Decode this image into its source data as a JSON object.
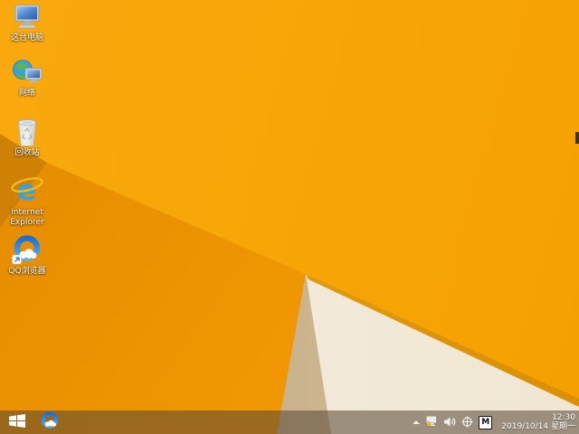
{
  "wallpaper": {
    "base_color": "#F7A506",
    "facet_dark_color": "#CE8104",
    "facet_medium_color": "#EE9402",
    "facet_cream_color": "#F2EADA",
    "facet_taupe_color": "#C9AF85",
    "edge_line_color": "#DC9510"
  },
  "desktop": {
    "icons": [
      {
        "name": "this-pc",
        "label": "这台电脑"
      },
      {
        "name": "network",
        "label": "网络"
      },
      {
        "name": "recycle-bin",
        "label": "回收站"
      },
      {
        "name": "internet-explorer",
        "label": "Internet Explorer"
      },
      {
        "name": "qq-browser",
        "label": "QQ浏览器"
      }
    ]
  },
  "taskbar": {
    "start_button": "windows-start",
    "pinned": [
      {
        "name": "qq-browser"
      }
    ],
    "tray": {
      "icons": [
        "show-hidden-icons",
        "network-warning",
        "volume",
        "crosshair-tool",
        "ime-mode"
      ],
      "ime_indicator": "M",
      "time": "12:30",
      "date": "2019/10/14 星期一"
    }
  }
}
